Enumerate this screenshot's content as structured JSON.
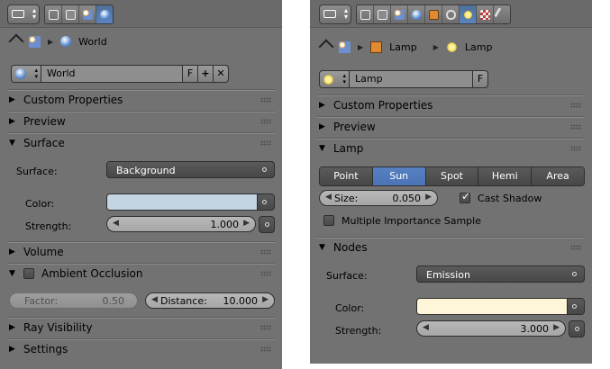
{
  "left_panel": {
    "breadcrumb": {
      "item": "World"
    },
    "datablock": {
      "name": "World",
      "fake_user": "F"
    },
    "sections": {
      "custom_properties": "Custom Properties",
      "preview": "Preview",
      "surface": "Surface",
      "volume": "Volume",
      "ambient_occlusion": "Ambient Occlusion",
      "ray_visibility": "Ray Visibility",
      "settings": "Settings"
    },
    "surface": {
      "surface_label": "Surface:",
      "surface_value": "Background",
      "color_label": "Color:",
      "color_hex": "#c3d5e3",
      "strength_label": "Strength:",
      "strength_value": "1.000"
    },
    "ambient_occlusion": {
      "enabled": false,
      "factor_label": "Factor:",
      "factor_value": "0.50",
      "distance_label": "Distance:",
      "distance_value": "10.000"
    }
  },
  "right_panel": {
    "breadcrumb": {
      "item1": "Lamp",
      "item2": "Lamp"
    },
    "datablock": {
      "name": "Lamp",
      "fake_user": "F"
    },
    "sections": {
      "custom_properties": "Custom Properties",
      "preview": "Preview",
      "lamp": "Lamp",
      "nodes": "Nodes"
    },
    "lamp": {
      "types": [
        "Point",
        "Sun",
        "Spot",
        "Hemi",
        "Area"
      ],
      "selected_type": "Sun",
      "size_label": "Size:",
      "size_value": "0.050",
      "cast_shadow_label": "Cast Shadow",
      "cast_shadow": true,
      "mis_label": "Multiple Importance Sample",
      "mis": false
    },
    "nodes": {
      "surface_label": "Surface:",
      "surface_value": "Emission",
      "color_label": "Color:",
      "color_hex": "#fff5d8",
      "strength_label": "Strength:",
      "strength_value": "3.000"
    }
  },
  "colors": {
    "panel_bg": "#727272",
    "active_tab": "#5680c2",
    "field_dark": "#4f4f4f"
  }
}
